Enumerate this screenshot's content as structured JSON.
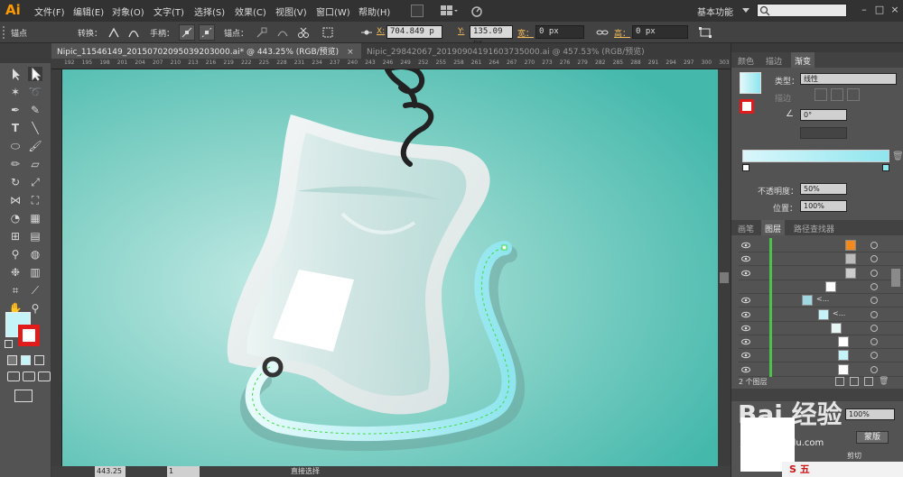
{
  "app": {
    "logo": "Ai",
    "workspace": "基本功能"
  },
  "menu": [
    "文件(F)",
    "编辑(E)",
    "对象(O)",
    "文字(T)",
    "选择(S)",
    "效果(C)",
    "视图(V)",
    "窗口(W)",
    "帮助(H)"
  ],
  "control": {
    "context_label": "锚点",
    "convert_label": "转换：",
    "handle_label": "手柄：",
    "anchor_label": "锚点：",
    "x_label": "X:",
    "x_value": "704.849 p",
    "y_label": "Y:",
    "y_value": "135.09 px",
    "w_label": "宽：",
    "w_value": "0 px",
    "h_label": "高：",
    "h_value": "0 px"
  },
  "tabs": [
    {
      "label": "Nipic_11546149_20150702095039203000.ai* @ 443.25% (RGB/预览)",
      "close": "×"
    },
    {
      "label": "Nipic_29842067_20190904191603735000.ai @ 457.53% (RGB/预览)",
      "close": ""
    }
  ],
  "ruler_numbers": [
    "192",
    "195",
    "198",
    "201",
    "204",
    "207",
    "210",
    "213",
    "216",
    "219",
    "222",
    "225",
    "228",
    "231",
    "234",
    "237",
    "240",
    "243",
    "246",
    "249",
    "252",
    "255",
    "258",
    "261",
    "264",
    "267",
    "270",
    "273",
    "276",
    "279",
    "282",
    "285",
    "288",
    "291",
    "294",
    "297",
    "300",
    "303"
  ],
  "gradient_panel": {
    "tabs": [
      "颜色",
      "描边",
      "渐变"
    ],
    "active_tab": "渐变",
    "type_label": "类型：",
    "type_value": "线性",
    "stroke_label": "描边",
    "angle_value": "0°",
    "opacity_label": "不透明度：",
    "opacity_value": "50%",
    "position_label": "位置：",
    "position_value": "100%",
    "gradient_start": "#d9f7fb",
    "gradient_end": "#8fe5ee"
  },
  "layers_panel": {
    "tabs": [
      "画笔",
      "图层",
      "路径查找器"
    ],
    "active_tab": "图层",
    "footer_count": "2 个图层",
    "row_labels": [
      "",
      "",
      "",
      "",
      "<...",
      "<...",
      "",
      "",
      "",
      ""
    ],
    "opacity_readout": "100%",
    "button_label": "蒙版",
    "clip_label": "剪切"
  },
  "status": {
    "zoom": "443.25",
    "page": "1",
    "tool": "直接选择"
  },
  "watermark": {
    "text": "Bai 经验",
    "sub": "jingyan.baidu.com",
    "ime": "S 五"
  },
  "colors": {
    "canvas_bg": "#45b8ac",
    "accent_orange": "#ff9a00",
    "selection_green": "#3fdc3f"
  }
}
